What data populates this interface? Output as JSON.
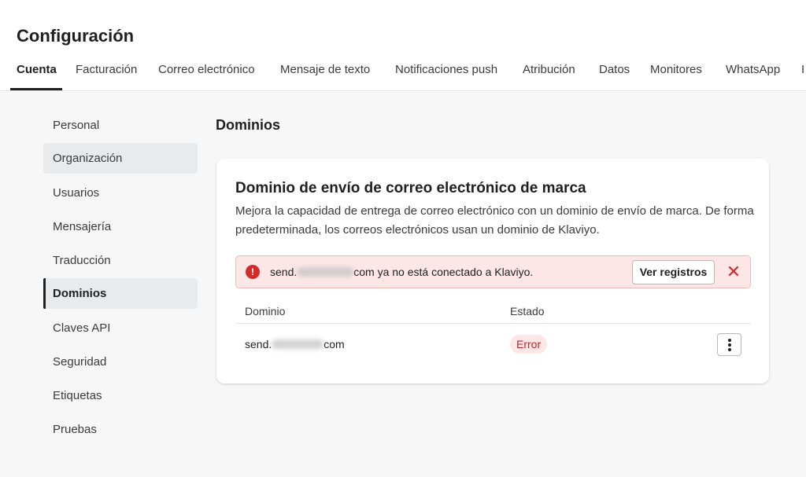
{
  "page_title": "Configuración",
  "tabs": [
    {
      "label": "Cuenta",
      "active": true
    },
    {
      "label": "Facturación"
    },
    {
      "label": "Correo electrónico"
    },
    {
      "label": "Mensaje de texto"
    },
    {
      "label": "Notificaciones push"
    },
    {
      "label": "Atribución"
    },
    {
      "label": "Datos"
    },
    {
      "label": "Monitores"
    },
    {
      "label": "WhatsApp"
    },
    {
      "label": "I"
    }
  ],
  "sidebar": {
    "items": [
      {
        "label": "Personal"
      },
      {
        "label": "Organización",
        "hover": true
      },
      {
        "label": "Usuarios"
      },
      {
        "label": "Mensajería"
      },
      {
        "label": "Traducción"
      },
      {
        "label": "Dominios",
        "active": true
      },
      {
        "label": "Claves API"
      },
      {
        "label": "Seguridad"
      },
      {
        "label": "Etiquetas"
      },
      {
        "label": "Pruebas"
      }
    ]
  },
  "main": {
    "section_title": "Dominios",
    "card": {
      "title": "Dominio de envío de correo electrónico de marca",
      "description": "Mejora la capacidad de entrega de correo electrónico con un dominio de envío de marca. De forma predeterminada, los correos electrónicos usan un dominio de Klaviyo.",
      "alert": {
        "icon": "error-circle-icon",
        "icon_glyph": "!",
        "text_prefix": "send.",
        "text_suffix": "com ya no está conectado a Klaviyo.",
        "button_label": "Ver registros",
        "close_glyph": "✕"
      },
      "table": {
        "columns": [
          "Dominio",
          "Estado"
        ],
        "rows": [
          {
            "domain_prefix": "send.",
            "domain_suffix": "com",
            "status": "Error"
          }
        ]
      }
    }
  },
  "colors": {
    "error": "#d12b2b",
    "error_bg": "#fce6e6",
    "text": "#1f1f1f",
    "sidebar_active_bg": "#e9eaeb",
    "content_bg": "#f7f7f7"
  }
}
